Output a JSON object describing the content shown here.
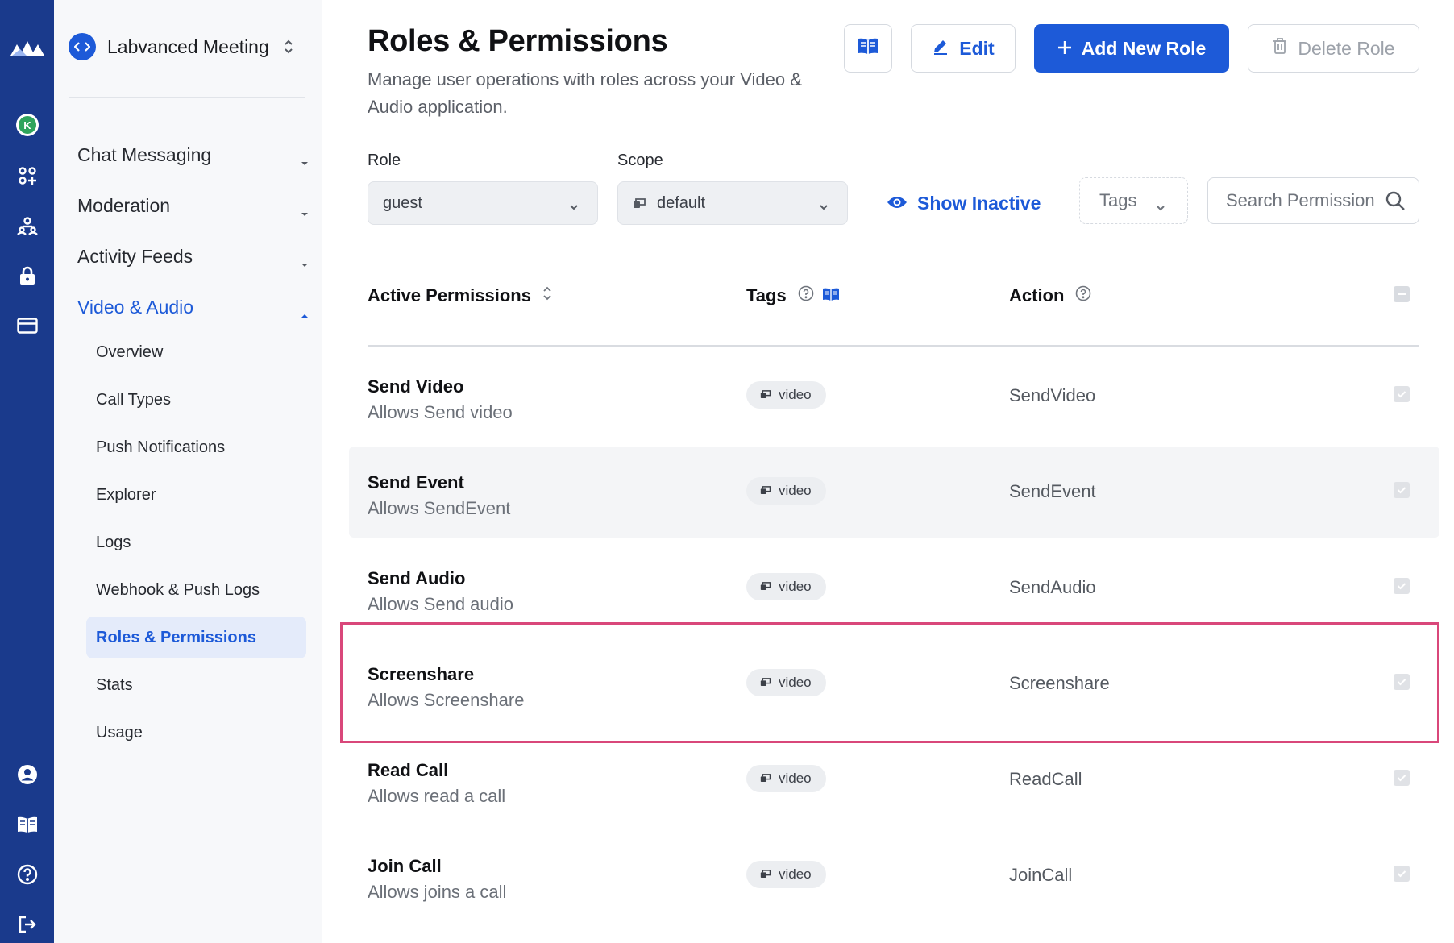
{
  "app": {
    "name": "Labvanced Meeting"
  },
  "rail": {
    "icons": [
      "brand-logo-icon",
      "organization-avatar-icon",
      "apps-grid-icon",
      "users-icon",
      "lock-icon",
      "billing-card-icon",
      "account-icon",
      "docs-book-icon",
      "help-icon",
      "logout-icon"
    ],
    "avatar_letter": "K"
  },
  "sidebar": {
    "groups": [
      {
        "label": "Chat Messaging",
        "expanded": false
      },
      {
        "label": "Moderation",
        "expanded": false
      },
      {
        "label": "Activity Feeds",
        "expanded": false
      },
      {
        "label": "Video & Audio",
        "expanded": true
      }
    ],
    "sub_items": [
      "Overview",
      "Call Types",
      "Push Notifications",
      "Explorer",
      "Logs",
      "Webhook & Push Logs",
      "Roles & Permissions",
      "Stats",
      "Usage"
    ],
    "selected_item": "Roles & Permissions"
  },
  "page": {
    "title": "Roles & Permissions",
    "description": "Manage user operations with roles across your Video & Audio application."
  },
  "toolbar": {
    "edit_label": "Edit",
    "add_label": "Add New Role",
    "delete_label": "Delete Role"
  },
  "filters": {
    "role_label": "Role",
    "role_value": "guest",
    "scope_label": "Scope",
    "scope_value": "default",
    "show_inactive_label": "Show Inactive",
    "tags_label": "Tags",
    "search_placeholder": "Search Permissions"
  },
  "table": {
    "headers": {
      "permissions": "Active Permissions",
      "tags": "Tags",
      "action": "Action"
    },
    "rows": [
      {
        "name": "Send Video",
        "description": "Allows Send video",
        "tag": "video",
        "action": "SendVideo",
        "checked": true
      },
      {
        "name": "Send Event",
        "description": "Allows SendEvent",
        "tag": "video",
        "action": "SendEvent",
        "checked": true
      },
      {
        "name": "Send Audio",
        "description": "Allows Send audio",
        "tag": "video",
        "action": "SendAudio",
        "checked": true
      },
      {
        "name": "Screenshare",
        "description": "Allows Screenshare",
        "tag": "video",
        "action": "Screenshare",
        "checked": true
      },
      {
        "name": "Read Call",
        "description": "Allows read a call",
        "tag": "video",
        "action": "ReadCall",
        "checked": true
      },
      {
        "name": "Join Call",
        "description": "Allows joins a call",
        "tag": "video",
        "action": "JoinCall",
        "checked": true
      }
    ],
    "highlighted_row": "Screenshare"
  },
  "colors": {
    "rail": "#1a3a8c",
    "accent": "#1d5ad8",
    "highlight": "#d9477a",
    "avatar": "#2fa45c"
  }
}
